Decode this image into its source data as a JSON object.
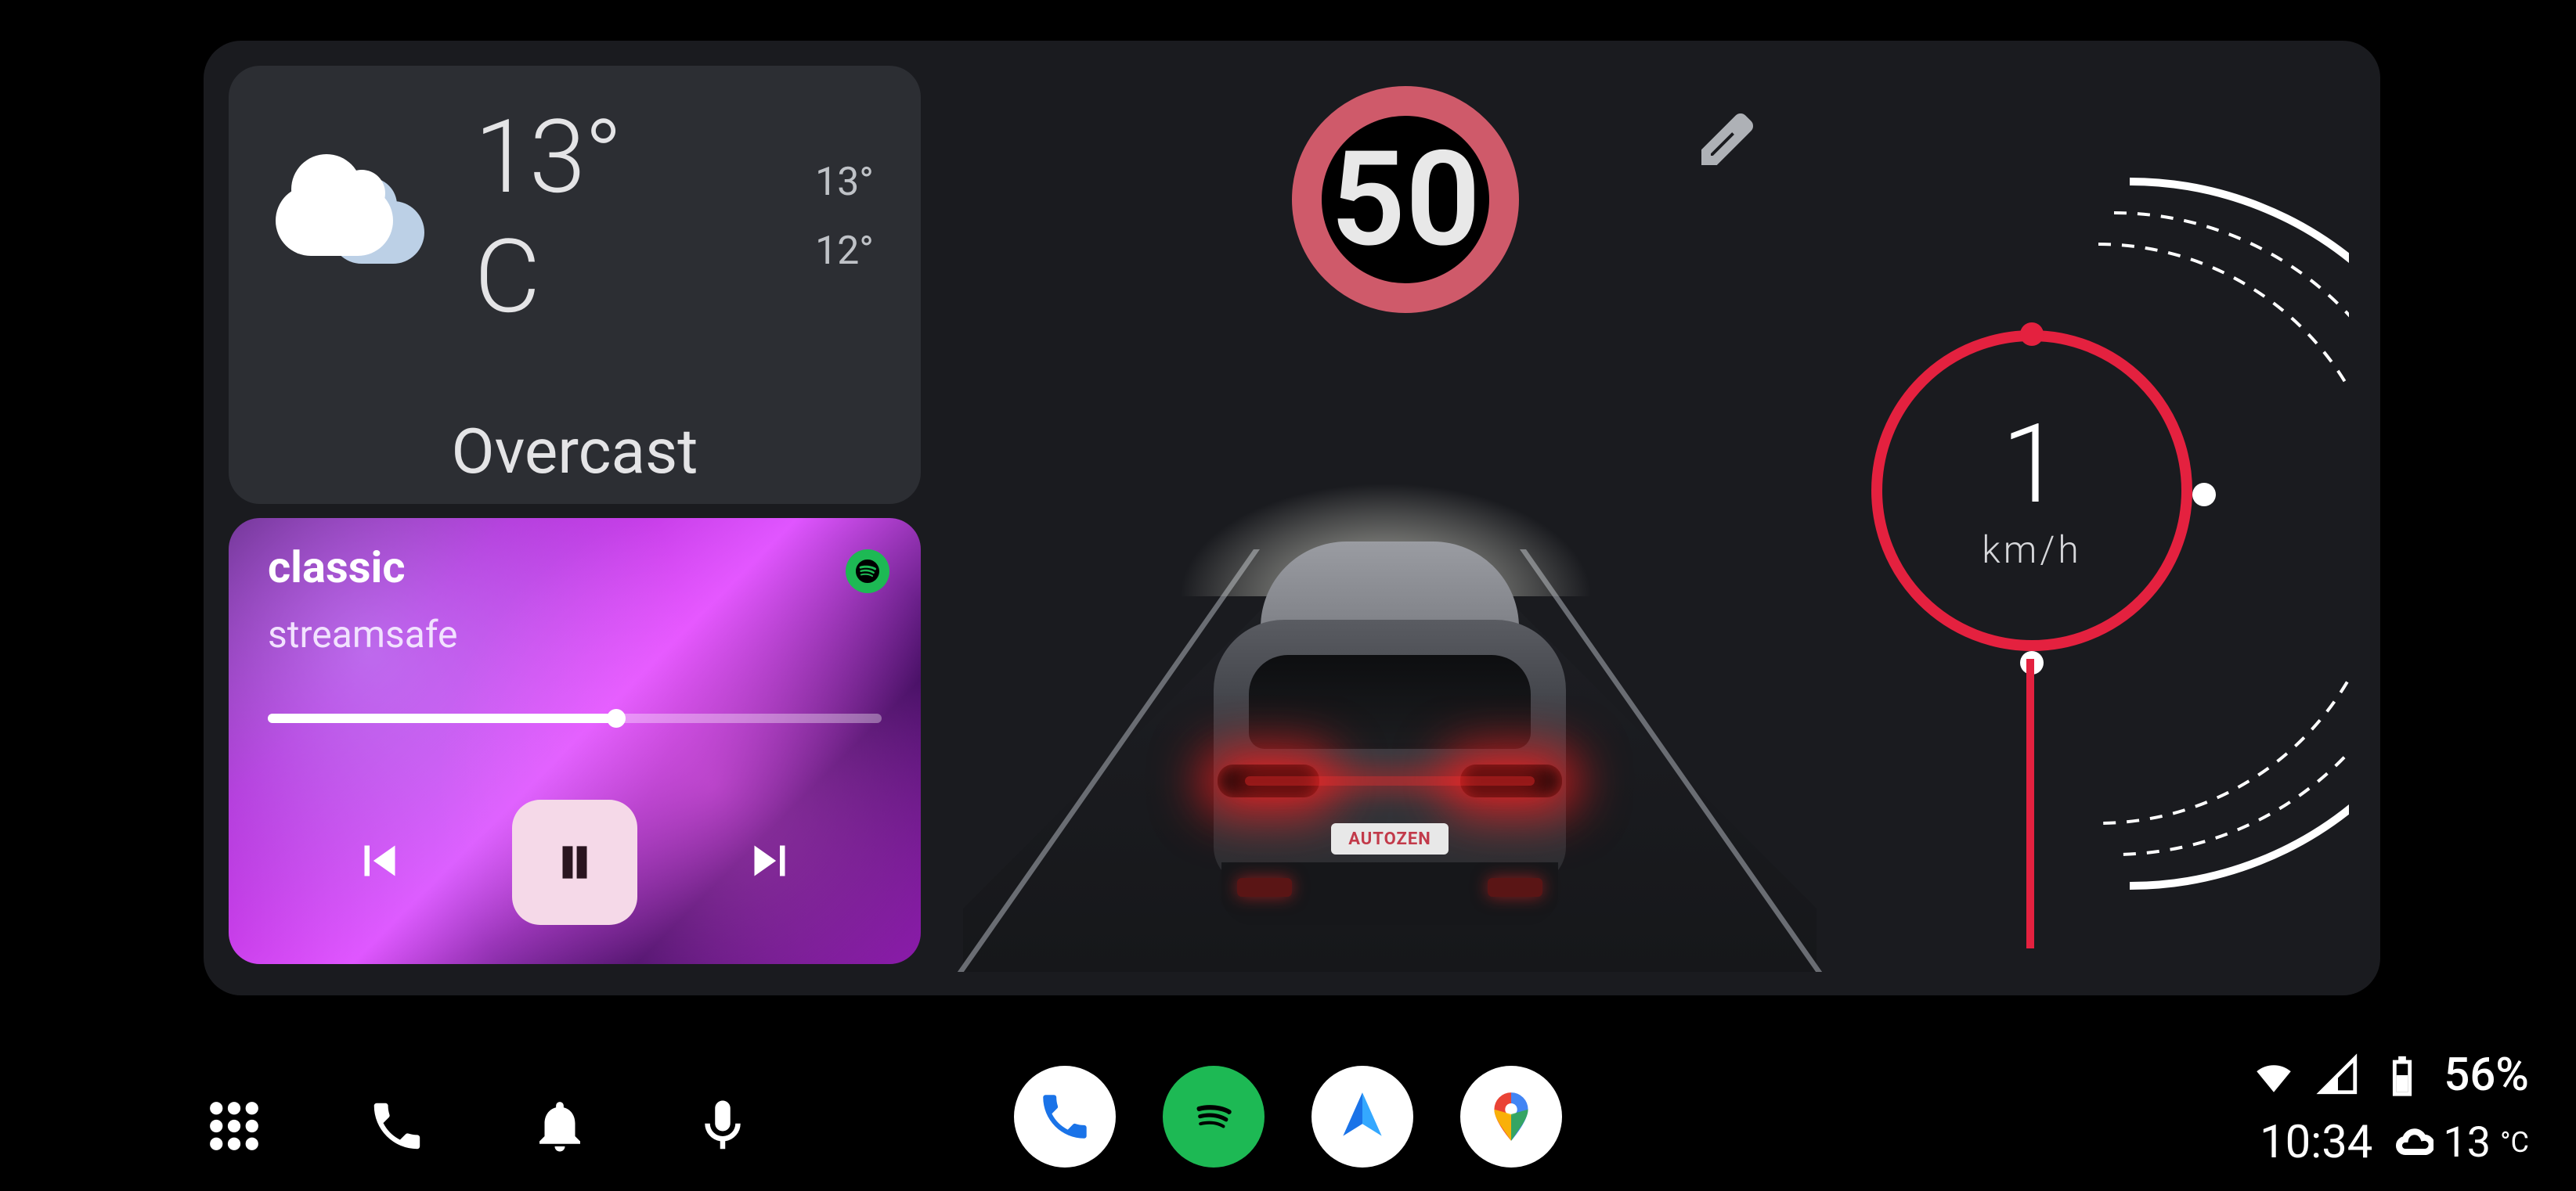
{
  "weather": {
    "temp": "13° C",
    "high": "13°",
    "low": "12°",
    "condition": "Overcast"
  },
  "music": {
    "title": "classic",
    "artist": "streamsafe",
    "progress_pct": 57,
    "service": "spotify"
  },
  "driving": {
    "speed_limit": "50",
    "plate": "AUTOZEN"
  },
  "speedo": {
    "value": "1",
    "unit": "km/h"
  },
  "status": {
    "battery": "56%",
    "clock": "10:34",
    "temp": "13",
    "temp_unit": "°C"
  },
  "colors": {
    "accent": "#e4213f",
    "panel": "#1a1b1f",
    "card": "#2c2e33",
    "spotify": "#1db954"
  }
}
